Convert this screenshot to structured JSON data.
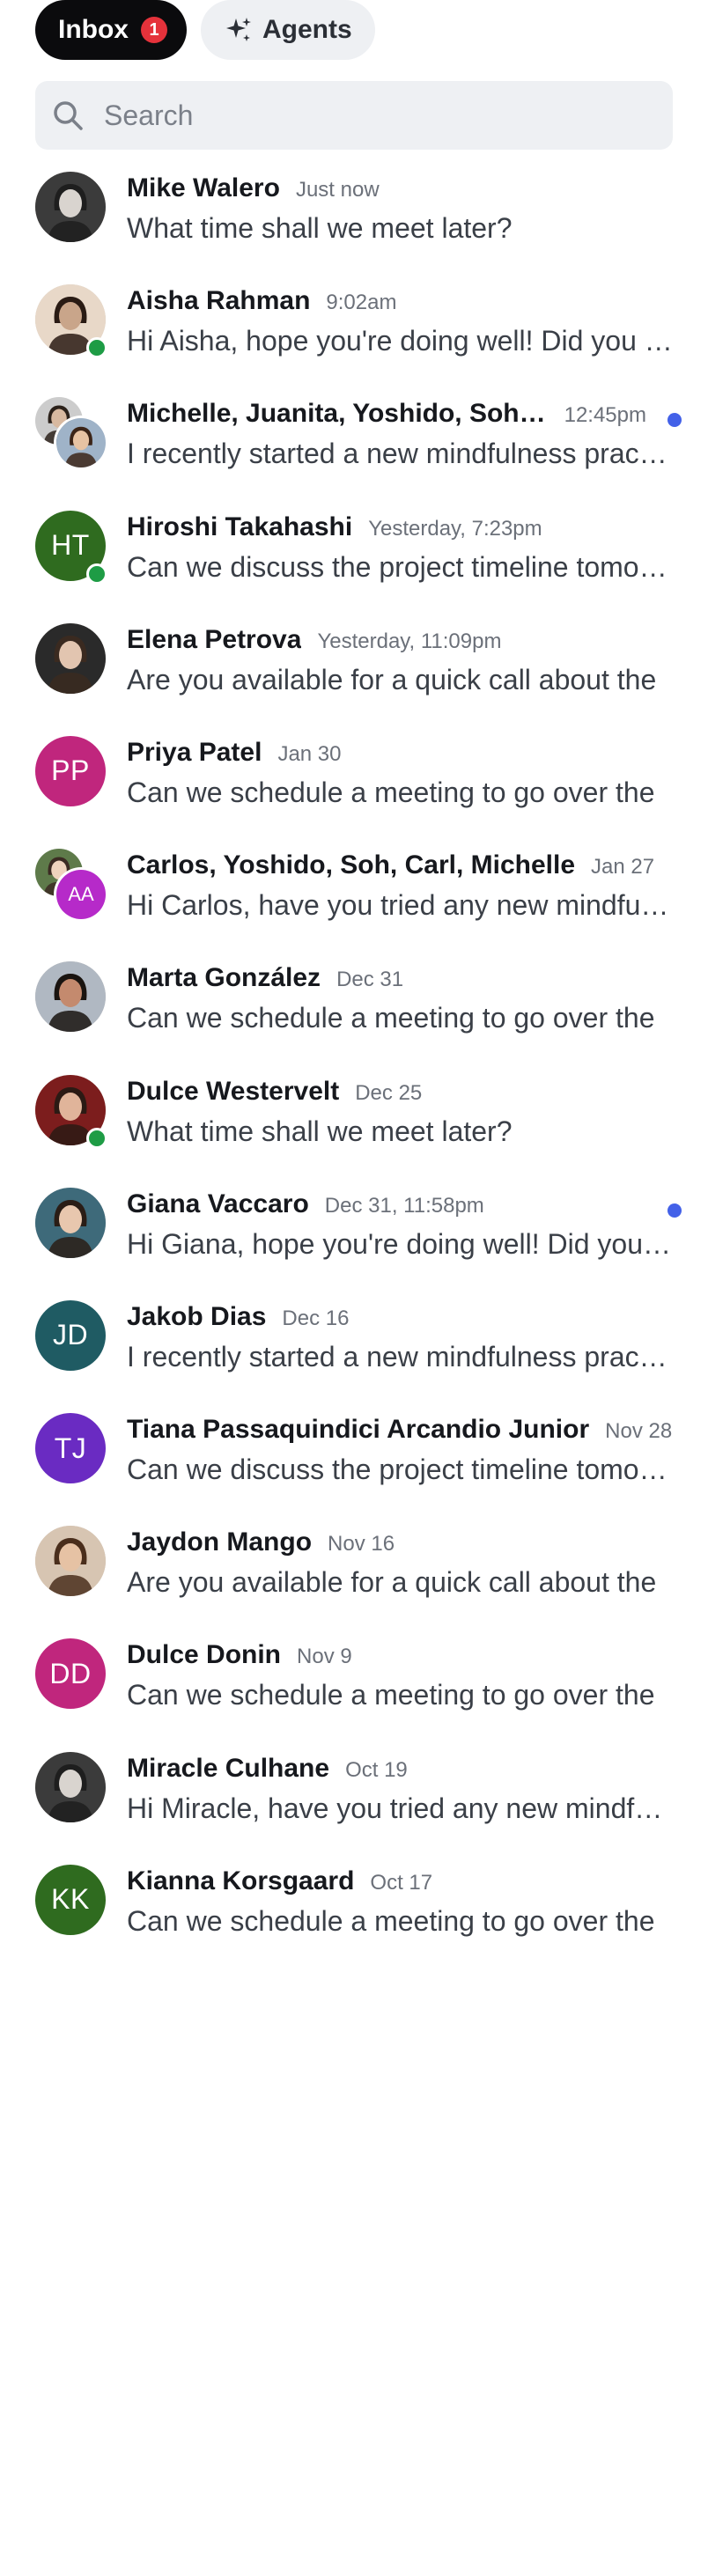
{
  "tabs": {
    "inbox_label": "Inbox",
    "inbox_badge": "1",
    "agents_label": "Agents"
  },
  "search": {
    "placeholder": "Search"
  },
  "colors": {
    "accent_unread": "#4361e8",
    "online": "#1e9c45",
    "badge": "#e5323b"
  },
  "conversations": [
    {
      "name": "Mike Walero",
      "time": "Just now",
      "preview": "What time shall we meet later?",
      "avatar": "photo",
      "online": false,
      "unread": false
    },
    {
      "name": "Aisha Rahman",
      "time": "9:02am",
      "preview": "Hi Aisha, hope you're doing well! Did you get a chance to",
      "avatar": "photo",
      "online": true,
      "unread": false
    },
    {
      "name": "Michelle, Juanita, Yoshido, Soh, Carl",
      "time": "12:45pm",
      "preview": "I recently started a new mindfulness practice",
      "avatar": "group-photo",
      "online": false,
      "unread": true
    },
    {
      "name": "Hiroshi Takahashi",
      "time": "Yesterday, 7:23pm",
      "preview": "Can we discuss the project timeline tomorrow?",
      "avatar": "HT",
      "online": true,
      "unread": false
    },
    {
      "name": "Elena Petrova",
      "time": "Yesterday, 11:09pm",
      "preview": "Are you available for a quick call about the",
      "avatar": "photo",
      "online": false,
      "unread": false
    },
    {
      "name": "Priya Patel",
      "time": "Jan 30",
      "preview": "Can we schedule a meeting to go over the",
      "avatar": "PP",
      "online": false,
      "unread": false
    },
    {
      "name": "Carlos, Yoshido, Soh, Carl, Michelle",
      "time": "Jan 27",
      "preview": "Hi Carlos, have you tried any new mindfulness",
      "avatar": "group-AA",
      "online": false,
      "unread": false
    },
    {
      "name": "Marta González",
      "time": "Dec 31",
      "preview": "Can we schedule a meeting to go over the",
      "avatar": "photo",
      "online": false,
      "unread": false
    },
    {
      "name": "Dulce Westervelt",
      "time": "Dec 25",
      "preview": "What time shall we meet later?",
      "avatar": "photo",
      "online": true,
      "unread": false
    },
    {
      "name": "Giana Vaccaro",
      "time": "Dec 31, 11:58pm",
      "preview": "Hi Giana, hope you're doing well! Did you get a chance to",
      "avatar": "photo",
      "online": false,
      "unread": true
    },
    {
      "name": "Jakob Dias",
      "time": "Dec 16",
      "preview": "I recently started a new mindfulness practice",
      "avatar": "JD",
      "online": false,
      "unread": false
    },
    {
      "name": "Tiana Passaquindici Arcandio Junior",
      "time": "Nov 28",
      "preview": "Can we discuss the project timeline tomorrow?",
      "avatar": "TJ",
      "online": false,
      "unread": false
    },
    {
      "name": "Jaydon Mango",
      "time": "Nov 16",
      "preview": "Are you available for a quick call about the",
      "avatar": "photo",
      "online": false,
      "unread": false
    },
    {
      "name": "Dulce Donin",
      "time": "Nov 9",
      "preview": "Can we schedule a meeting to go over the",
      "avatar": "DD",
      "online": false,
      "unread": false
    },
    {
      "name": "Miracle Culhane",
      "time": "Oct 19",
      "preview": "Hi Miracle, have you tried any new mindfulness",
      "avatar": "photo",
      "online": false,
      "unread": false
    },
    {
      "name": "Kianna Korsgaard",
      "time": "Oct 17",
      "preview": "Can we schedule a meeting to go over the",
      "avatar": "KK",
      "online": false,
      "unread": false
    }
  ],
  "group_second_initials": "AA"
}
